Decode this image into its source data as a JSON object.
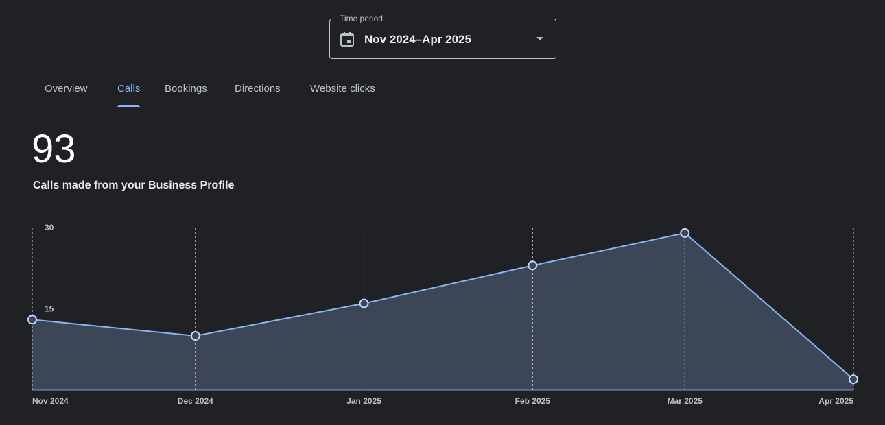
{
  "time_period": {
    "label": "Time period",
    "value": "Nov 2024–Apr 2025",
    "icon": "calendar-icon"
  },
  "tabs": [
    {
      "label": "Overview",
      "active": false
    },
    {
      "label": "Calls",
      "active": true
    },
    {
      "label": "Bookings",
      "active": false
    },
    {
      "label": "Directions",
      "active": false
    },
    {
      "label": "Website clicks",
      "active": false
    }
  ],
  "metric": {
    "value": "93",
    "caption": "Calls made from your Business Profile"
  },
  "colors": {
    "background": "#202124",
    "accent": "#8ab4f8",
    "area_fill": "#3c4657",
    "text": "#e8eaed"
  },
  "chart_data": {
    "type": "area",
    "title": "",
    "xlabel": "",
    "ylabel": "",
    "x": [
      "Nov 2024",
      "Dec 2024",
      "Jan 2025",
      "Feb 2025",
      "Mar 2025",
      "Apr 2025"
    ],
    "x_dates": [
      "2024-11-01",
      "2024-12-01",
      "2025-01-01",
      "2025-02-01",
      "2025-03-01",
      "2025-04-01"
    ],
    "yticks": [
      "15",
      "30"
    ],
    "ylim": [
      0,
      30
    ],
    "grid": "vertical-dashed",
    "series": [
      {
        "values": [
          13,
          10,
          16,
          23,
          29,
          2
        ]
      }
    ]
  }
}
